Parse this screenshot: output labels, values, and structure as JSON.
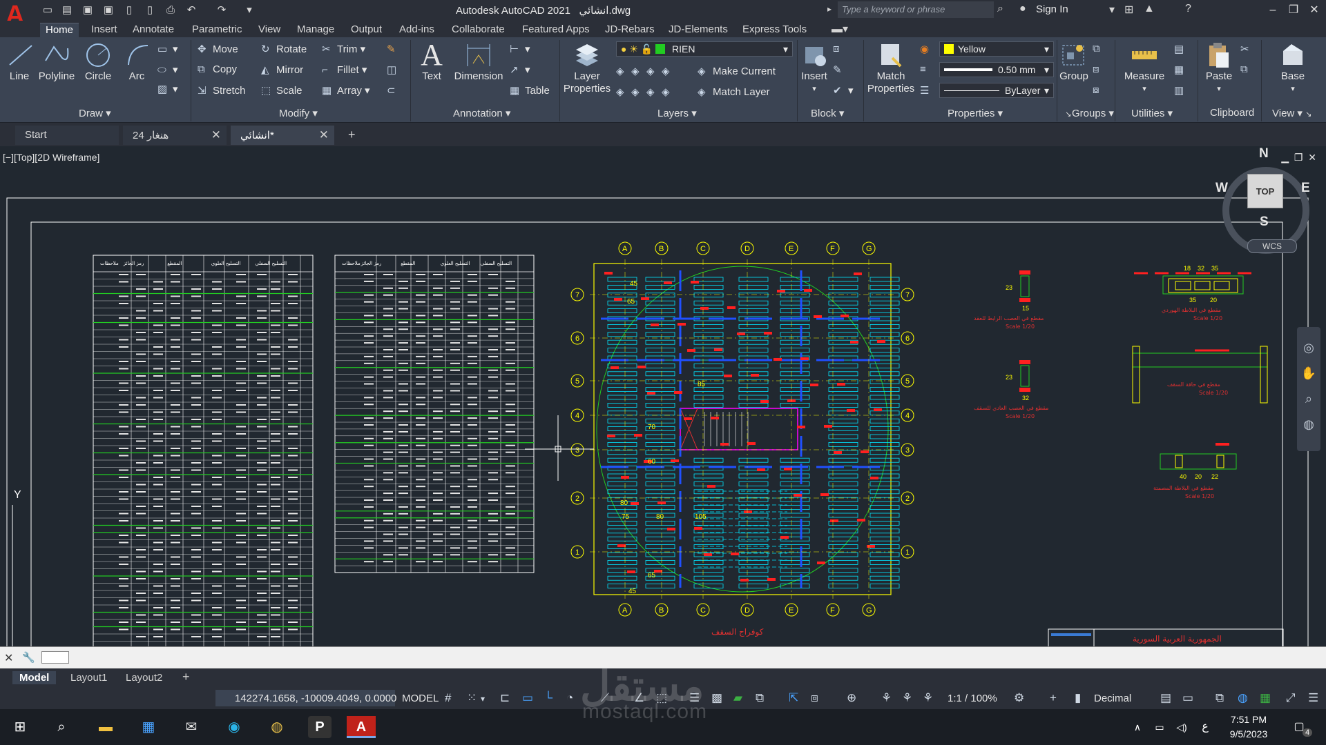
{
  "app": {
    "logo": "A",
    "title": "Autodesk AutoCAD 2021",
    "filename": "انشائي.dwg",
    "search_placeholder": "Type a keyword or phrase",
    "sign_in": "Sign In"
  },
  "menu_tabs": [
    "Home",
    "Insert",
    "Annotate",
    "Parametric",
    "View",
    "Manage",
    "Output",
    "Add-ins",
    "Collaborate",
    "Featured Apps",
    "JD-Rebars",
    "JD-Elements",
    "Express Tools"
  ],
  "ribbon": {
    "draw": {
      "title": "Draw",
      "line": "Line",
      "polyline": "Polyline",
      "circle": "Circle",
      "arc": "Arc"
    },
    "modify": {
      "title": "Modify",
      "move": "Move",
      "rotate": "Rotate",
      "trim": "Trim",
      "copy": "Copy",
      "mirror": "Mirror",
      "fillet": "Fillet",
      "stretch": "Stretch",
      "scale": "Scale",
      "array": "Array"
    },
    "annotation": {
      "title": "Annotation",
      "text": "Text",
      "dimension": "Dimension",
      "table": "Table"
    },
    "layers": {
      "title": "Layers",
      "layer_properties": "Layer Properties",
      "current_layer": "RIEN",
      "make_current": "Make Current",
      "match_layer": "Match Layer"
    },
    "block": {
      "title": "Block",
      "insert": "Insert"
    },
    "properties": {
      "title": "Properties",
      "match_properties": "Match Properties",
      "color": "Yellow",
      "lineweight": "0.50 mm",
      "linetype": "ByLayer"
    },
    "groups": {
      "title": "Groups",
      "group": "Group"
    },
    "utilities": {
      "title": "Utilities",
      "measure": "Measure"
    },
    "clipboard": {
      "title": "Clipboard",
      "paste": "Paste"
    },
    "view": {
      "title": "View",
      "base": "Base"
    }
  },
  "file_tabs": [
    {
      "label": "Start"
    },
    {
      "label": "هنغار 24"
    },
    {
      "label": "انشائي*"
    }
  ],
  "viewport": {
    "label": "[−][Top][2D Wireframe]",
    "viewcube": {
      "top": "TOP",
      "n": "N",
      "s": "S",
      "e": "E",
      "w": "W",
      "wcs": "WCS"
    },
    "ucs_y": "Y",
    "grid_letters": [
      "A",
      "B",
      "C",
      "D",
      "E",
      "F",
      "G"
    ],
    "grid_numbers": [
      "7",
      "6",
      "5",
      "4",
      "3",
      "2",
      "1"
    ],
    "dims": [
      "45",
      "65",
      "85",
      "70",
      "60",
      "80",
      "75",
      "80",
      "105",
      "65",
      "45"
    ],
    "plan_title": "كوفراج السقف",
    "section_titles": [
      "مقطع في العصب الرابط للعقد",
      "مقطع في العصب العادي للسقف",
      "مقطع في البلاطة الهوردي",
      "مقطع في حافة السقف",
      "مقطع في البلاطة المصمتة"
    ],
    "scale_label": "Scale 1/20",
    "section_dims": [
      "23",
      "15",
      "23",
      "32",
      "18",
      "32",
      "35",
      "35",
      "20",
      "40",
      "20",
      "22"
    ],
    "titleblock_text": "الجمهورية العربية السورية",
    "table_headers": [
      "ملاحظات",
      "التسليح السفلي",
      "التسليح العلوي",
      "المقطع",
      "رمز الجائز"
    ]
  },
  "layout_tabs": [
    "Model",
    "Layout1",
    "Layout2"
  ],
  "status": {
    "coords": "142274.1658, -10009.4049, 0.0000",
    "mode": "MODEL",
    "scale": "1:1 / 100%",
    "units": "Decimal"
  },
  "taskbar": {
    "time": "7:51 PM",
    "date": "9/5/2023",
    "lang": "ع",
    "notif_count": "4"
  },
  "watermark": {
    "arabic": "مستقل",
    "latin": "mostaql.com"
  }
}
